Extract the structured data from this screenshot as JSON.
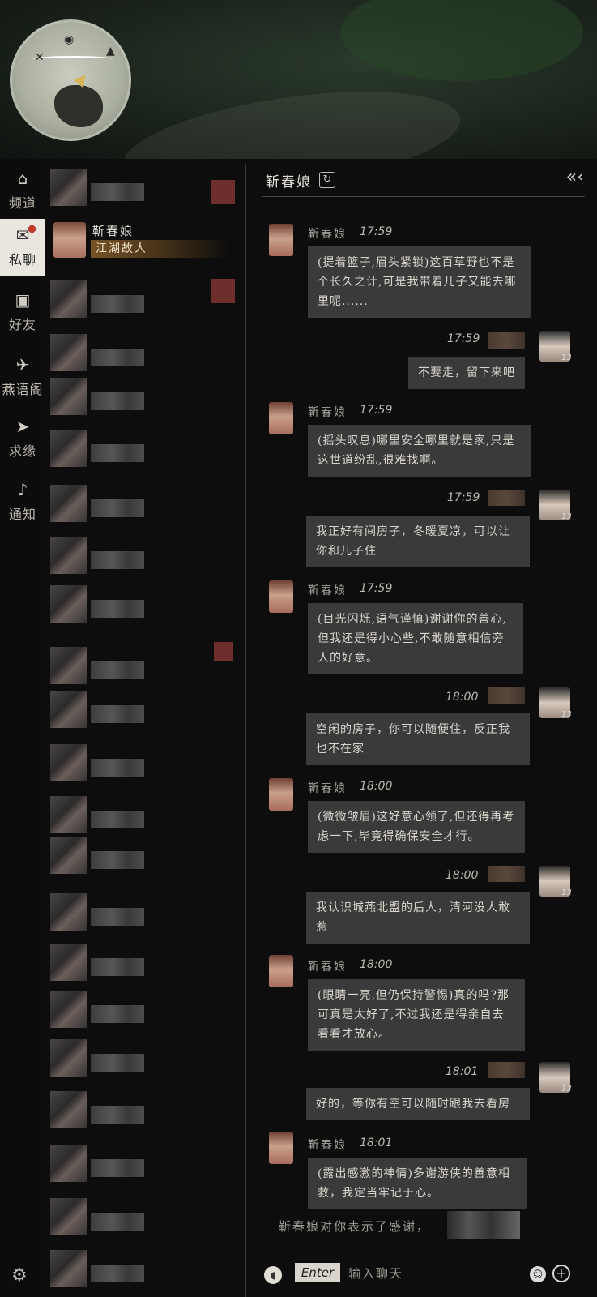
{
  "rail": {
    "items": [
      {
        "label": "频道",
        "icon": "home-icon"
      },
      {
        "label": "私聊",
        "icon": "chat-icon"
      },
      {
        "label": "好友",
        "icon": "contacts-icon"
      },
      {
        "label": "燕语阁",
        "icon": "swallow-icon"
      },
      {
        "label": "求缘",
        "icon": "paper-plane-icon"
      },
      {
        "label": "通知",
        "icon": "bell-icon"
      }
    ],
    "active": "私聊"
  },
  "list": {
    "active_contact": {
      "name": "靳春娘",
      "tag": "江湖故人"
    }
  },
  "chat": {
    "title": "靳春娘",
    "contact_name": "靳春娘",
    "self_level": "13",
    "messages": [
      {
        "from": "npc",
        "time": "17:59",
        "text": "(提着篮子,眉头紧锁)这百草野也不是个长久之计,可是我带着儿子又能去哪里呢......"
      },
      {
        "from": "self",
        "time": "17:59",
        "text": "不要走，留下来吧"
      },
      {
        "from": "npc",
        "time": "17:59",
        "text": "(摇头叹息)哪里安全哪里就是家,只是这世道纷乱,很难找啊。"
      },
      {
        "from": "self",
        "time": "17:59",
        "text": "我正好有间房子，冬暖夏凉，可以让你和儿子住"
      },
      {
        "from": "npc",
        "time": "17:59",
        "text": "(目光闪烁,语气谨慎)谢谢你的善心,但我还是得小心些,不敢随意相信旁人的好意。"
      },
      {
        "from": "self",
        "time": "18:00",
        "text": "空闲的房子，你可以随便住，反正我也不在家"
      },
      {
        "from": "npc",
        "time": "18:00",
        "text": "(微微皱眉)这好意心领了,但还得再考虑一下,毕竟得确保安全才行。"
      },
      {
        "from": "self",
        "time": "18:00",
        "text": "我认识城燕北盟的后人，清河没人敢惹"
      },
      {
        "from": "npc",
        "time": "18:00",
        "text": "(眼睛一亮,但仍保持警惕)真的吗?那可真是太好了,不过我还是得亲自去看看才放心。"
      },
      {
        "from": "self",
        "time": "18:01",
        "text": "好的，等你有空可以随时跟我去看房"
      },
      {
        "from": "npc",
        "time": "18:01",
        "text": "(露出感激的神情)多谢游侠的善意相救，我定当牢记于心。"
      }
    ],
    "system_note": "靳春娘对你表示了感谢，",
    "input": {
      "enter_label": "Enter",
      "placeholder": "输入聊天"
    }
  }
}
